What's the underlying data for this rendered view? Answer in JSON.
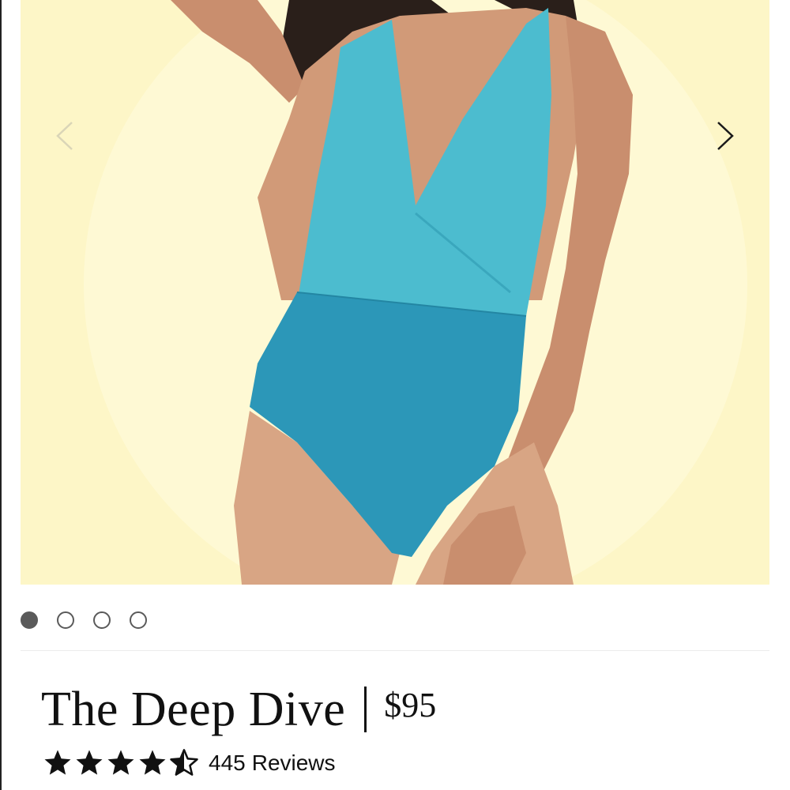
{
  "product": {
    "title": "The Deep Dive",
    "price": "$95"
  },
  "gallery": {
    "image_count": 4,
    "active_index": 0,
    "background_color": "#fdf6c7",
    "swimsuit_top_color": "#4cbccf",
    "swimsuit_bottom_color": "#2c97b8",
    "prev_icon": "chevron-left-icon",
    "next_icon": "chevron-right-icon"
  },
  "rating": {
    "stars": 4.5,
    "max_stars": 5,
    "review_count": "445",
    "review_label": "Reviews"
  }
}
